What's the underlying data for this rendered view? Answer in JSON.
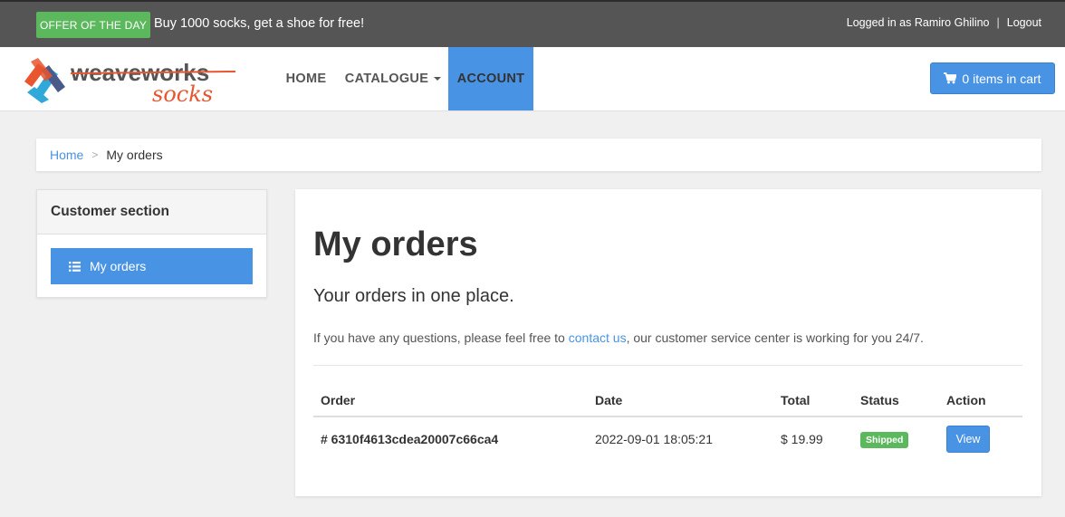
{
  "topbar": {
    "offer_label": "OFFER OF THE DAY",
    "offer_text": "Buy 1000 socks, get a shoe for free!",
    "logged_in_text": "Logged in as Ramiro Ghilino",
    "separator": "|",
    "logout_label": "Logout"
  },
  "navbar": {
    "logo_text_main": "weaveworks",
    "logo_text_sub": "socks",
    "items": [
      {
        "label": "HOME"
      },
      {
        "label": "CATALOGUE"
      },
      {
        "label": "ACCOUNT"
      }
    ],
    "cart_label": "0 items in cart"
  },
  "breadcrumb": {
    "home": "Home",
    "separator": ">",
    "current": "My orders"
  },
  "sidebar": {
    "title": "Customer section",
    "link_label": "My orders"
  },
  "main": {
    "title": "My orders",
    "lead": "Your orders in one place.",
    "info_prefix": "If you have any questions, please feel free to ",
    "info_link": "contact us",
    "info_suffix": ", our customer service center is working for you 24/7.",
    "table": {
      "headers": [
        "Order",
        "Date",
        "Total",
        "Status",
        "Action"
      ],
      "rows": [
        {
          "order": "# 6310f4613cdea20007c66ca4",
          "date": "2022-09-01 18:05:21",
          "total": "$ 19.99",
          "status": "Shipped",
          "action": "View"
        }
      ]
    }
  },
  "colors": {
    "accent": "#4993e4",
    "success": "#5cb85c",
    "topbar": "#555555"
  }
}
